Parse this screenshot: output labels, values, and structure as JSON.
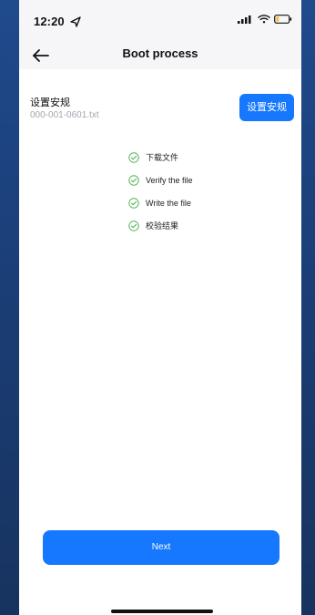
{
  "status_bar": {
    "time": "12:20"
  },
  "header": {
    "title": "Boot process",
    "back_icon": "back-arrow-icon"
  },
  "setting": {
    "title": "设置安规",
    "file_name": "000-001-0601.txt",
    "button_label": "设置安规"
  },
  "steps": [
    {
      "icon": "check-circle-icon",
      "label": "下载文件"
    },
    {
      "icon": "check-circle-icon",
      "label": "Verify the file"
    },
    {
      "icon": "check-circle-icon",
      "label": "Write the file"
    },
    {
      "icon": "check-circle-icon",
      "label": "校验结果"
    }
  ],
  "footer": {
    "next_label": "Next"
  },
  "colors": {
    "accent": "#1677ff",
    "success": "#59b35a",
    "muted_text": "#a1a6ad",
    "surface": "#f6f6f8"
  }
}
